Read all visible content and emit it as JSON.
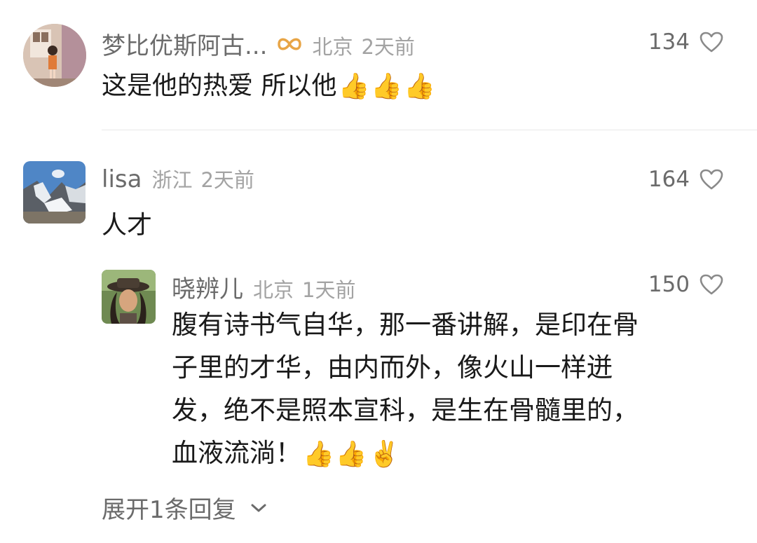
{
  "comments": [
    {
      "username": "梦比优斯阿古...",
      "badge_icon": "infinity-badge-icon",
      "location": "北京",
      "time": "2天前",
      "likes": "134",
      "text": "这是他的热爱 所以他",
      "emojis": [
        "👍",
        "👍",
        "👍"
      ]
    },
    {
      "username": "lisa",
      "location": "浙江",
      "time": "2天前",
      "likes": "164",
      "text": "人才",
      "reply": {
        "username": "晓辨儿",
        "location": "北京",
        "time": "1天前",
        "likes": "150",
        "text_lines": [
          "腹有诗书气自华，那一番讲解，是印在骨",
          "子里的才华，由内而外，像火山一样迸",
          "发，绝不是照本宣科，是生在骨髓里的，",
          "血液流淌！"
        ],
        "emojis": [
          "👍",
          "👍",
          "✌️"
        ]
      }
    }
  ],
  "expand_replies": "展开1条回复",
  "colors": {
    "username": "#6b6b6b",
    "meta": "#a3a3a3",
    "text": "#1a1a1a",
    "badge": "#e8a546"
  }
}
